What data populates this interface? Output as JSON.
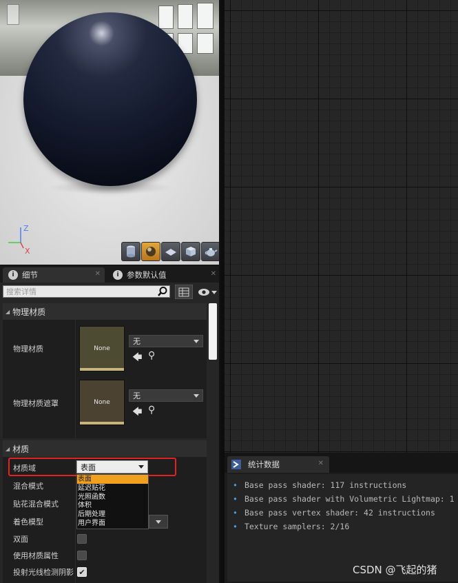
{
  "viewport": {
    "axes": {
      "z": "Z",
      "x": "X"
    },
    "toolbar": [
      {
        "icon": "cylinder-icon",
        "active": false
      },
      {
        "icon": "sphere-icon",
        "active": true
      },
      {
        "icon": "plane-icon",
        "active": false
      },
      {
        "icon": "cube-icon",
        "active": false
      },
      {
        "icon": "teapot-icon",
        "active": false
      }
    ]
  },
  "details": {
    "tabs": [
      {
        "label": "细节",
        "active": true
      },
      {
        "label": "参数默认值",
        "active": false
      }
    ],
    "search": {
      "placeholder": "搜索详情"
    },
    "physical_section": {
      "title": "物理材质",
      "rows": [
        {
          "label": "物理材质",
          "thumb": "None",
          "value": "无"
        },
        {
          "label": "物理材质遮罩",
          "thumb": "None",
          "value": "无"
        }
      ]
    },
    "material_section": {
      "title": "材质",
      "rows": {
        "domain": "材质域",
        "blend": "混合模式",
        "decal_blend": "贴花混合模式",
        "shading": "着色模型",
        "two_sided": "双面",
        "use_material_attributes": "使用材质属性",
        "raytraced_shadows": "投射光线检测阴影"
      },
      "domain_value": "表面",
      "domain_options": [
        "表面",
        "延迟贴花",
        "光照函数",
        "体积",
        "后期处理",
        "用户界面"
      ],
      "checkboxes": {
        "two_sided": false,
        "use_material_attributes": false,
        "raytraced_shadows": true
      }
    }
  },
  "stats": {
    "tab_label": "统计数据",
    "lines": [
      "Base pass shader: 117 instructions",
      "Base pass shader with Volumetric Lightmap: 1",
      "Base pass vertex shader: 42 instructions",
      "Texture samplers: 2/16"
    ]
  },
  "watermark": "CSDN @飞起的猪",
  "colors": {
    "accent": "#f0a01c",
    "highlight_box": "#e32323",
    "bullet": "#4aa0e0"
  }
}
